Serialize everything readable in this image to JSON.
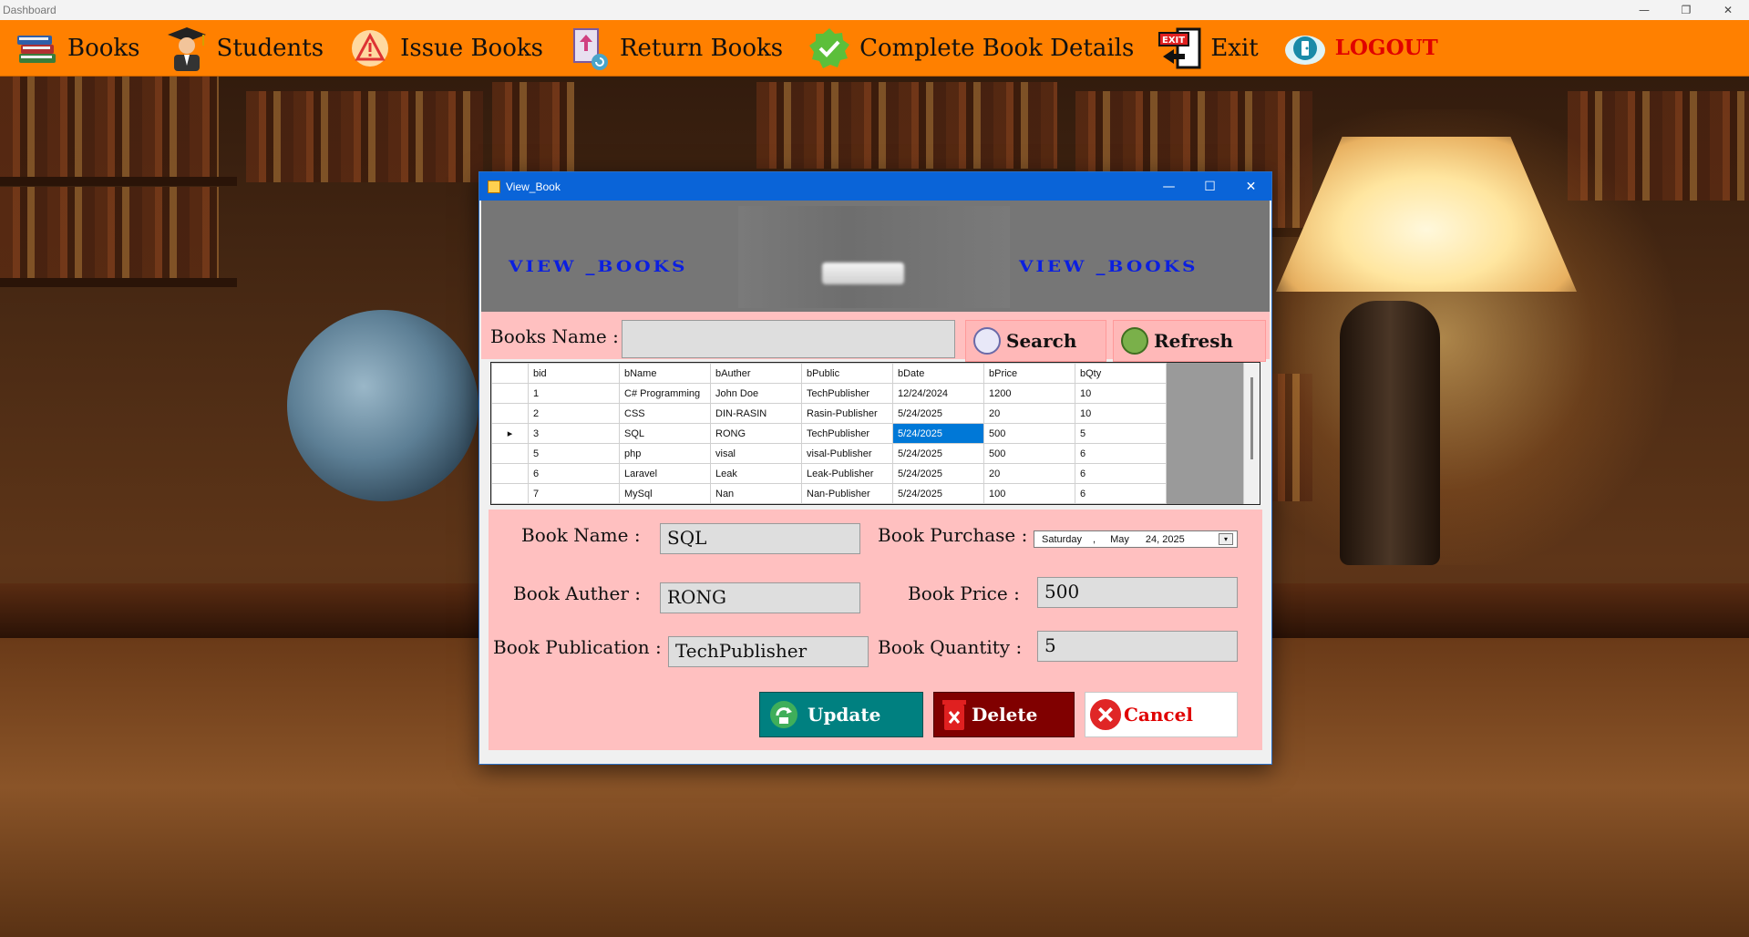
{
  "window": {
    "title": "Dashboard"
  },
  "menu": {
    "items": [
      {
        "label": "Books",
        "icon": "books-icon"
      },
      {
        "label": "Students",
        "icon": "graduate-icon"
      },
      {
        "label": "Issue Books",
        "icon": "warning-icon"
      },
      {
        "label": "Return Books",
        "icon": "return-book-icon"
      },
      {
        "label": "Complete Book Details",
        "icon": "check-badge-icon"
      },
      {
        "label": "Exit",
        "icon": "exit-door-icon"
      },
      {
        "label": "LOGOUT",
        "icon": "logout-icon"
      }
    ]
  },
  "dialog": {
    "title": "View_Book",
    "banner_left": "VIEW _BOOKS",
    "banner_right": "VIEW _BOOKS",
    "search": {
      "label": "Books Name :",
      "value": "",
      "search_button": "Search",
      "refresh_button": "Refresh"
    },
    "grid": {
      "columns": [
        "bid",
        "bName",
        "bAuther",
        "bPublic",
        "bDate",
        "bPrice",
        "bQty"
      ],
      "rows": [
        [
          "1",
          "C# Programming",
          "John Doe",
          "TechPublisher",
          "12/24/2024",
          "1200",
          "10"
        ],
        [
          "2",
          "CSS",
          "DIN-RASIN",
          "Rasin-Publisher",
          "5/24/2025",
          "20",
          "10"
        ],
        [
          "3",
          "SQL",
          "RONG",
          "TechPublisher",
          "5/24/2025",
          "500",
          "5"
        ],
        [
          "5",
          "php",
          "visal",
          "visal-Publisher",
          "5/24/2025",
          "500",
          "6"
        ],
        [
          "6",
          "Laravel",
          "Leak",
          "Leak-Publisher",
          "5/24/2025",
          "20",
          "6"
        ],
        [
          "7",
          "MySql",
          "Nan",
          "Nan-Publisher",
          "5/24/2025",
          "100",
          "6"
        ]
      ],
      "selected_row": 2,
      "selected_col": 4
    },
    "form": {
      "book_name_label": "Book Name :",
      "book_name": "SQL",
      "book_auther_label": "Book Auther :",
      "book_auther": "RONG",
      "book_publication_label": "Book Publication :",
      "book_publication": "TechPublisher",
      "book_purchase_label": "Book Purchase :",
      "purchase_day": "Saturday",
      "purchase_sep": ",",
      "purchase_month": "May",
      "purchase_date": "24, 2025",
      "book_price_label": "Book Price :",
      "book_price": "500",
      "book_quantity_label": "Book Quantity :",
      "book_quantity": "5"
    },
    "actions": {
      "update": "Update",
      "delete": "Delete",
      "cancel": "Cancel"
    }
  },
  "colors": {
    "menubar": "#ff8000",
    "banner_text": "#0b1fe0",
    "pink_panel": "#ffc0c0",
    "update_btn": "#008080",
    "delete_btn": "#800000",
    "selection": "#0078d7"
  }
}
